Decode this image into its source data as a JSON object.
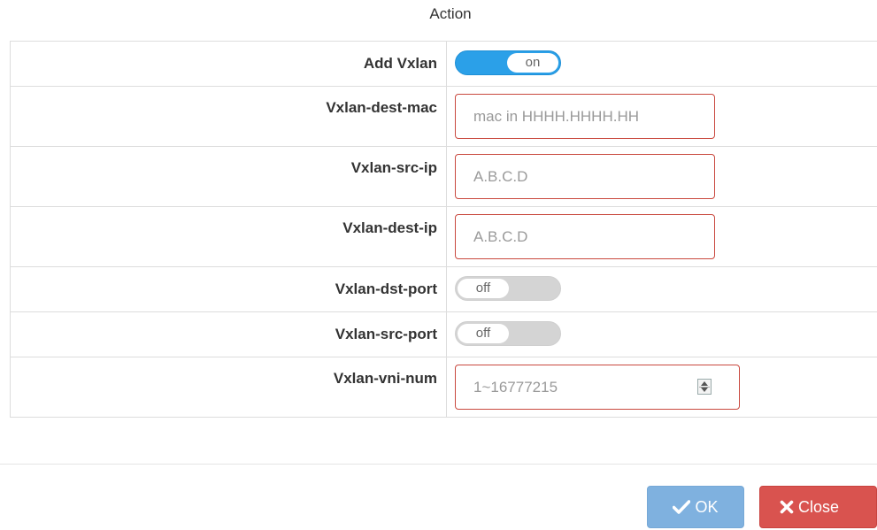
{
  "dialog": {
    "title": "Action"
  },
  "rows": {
    "add_vxlan": {
      "label": "Add Vxlan",
      "state": "on"
    },
    "dest_mac": {
      "label": "Vxlan-dest-mac",
      "placeholder": "mac in HHHH.HHHH.HH",
      "value": ""
    },
    "src_ip": {
      "label": "Vxlan-src-ip",
      "placeholder": "A.B.C.D",
      "value": ""
    },
    "dest_ip": {
      "label": "Vxlan-dest-ip",
      "placeholder": "A.B.C.D",
      "value": ""
    },
    "dst_port": {
      "label": "Vxlan-dst-port",
      "state": "off"
    },
    "src_port": {
      "label": "Vxlan-src-port",
      "state": "off"
    },
    "vni_num": {
      "label": "Vxlan-vni-num",
      "placeholder": "1~16777215",
      "value": ""
    }
  },
  "buttons": {
    "ok": {
      "label": "OK",
      "icon": "check-icon"
    },
    "close": {
      "label": "Close",
      "icon": "close-icon"
    }
  },
  "colors": {
    "switch_on": "#2ba0e8",
    "switch_off": "#d4d4d4",
    "invalid_border": "#c9493f",
    "ok_button": "#7fb1df",
    "close_button": "#d9534f"
  }
}
